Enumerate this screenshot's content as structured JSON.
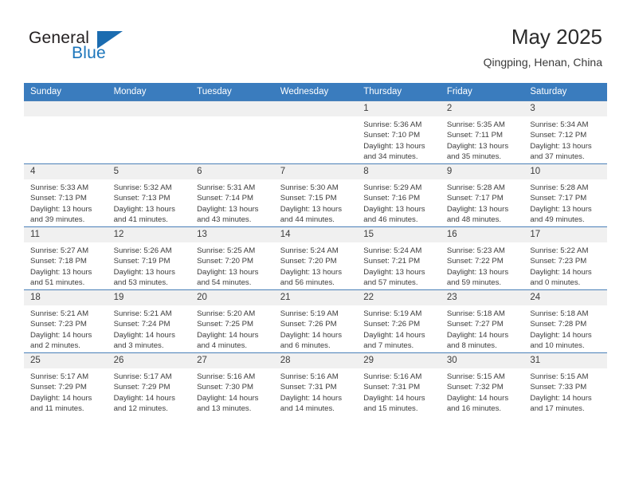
{
  "brand": {
    "name_top": "General",
    "name_bottom": "Blue",
    "flag_icon": "blue-triangle-flag"
  },
  "header": {
    "title": "May 2025",
    "location": "Qingping, Henan, China"
  },
  "theme": {
    "header_blue": "#3a7cbe",
    "brand_blue": "#1b75bb",
    "daynum_bg": "#f0f0f0",
    "text": "#3c3c3c"
  },
  "weekdays": [
    "Sunday",
    "Monday",
    "Tuesday",
    "Wednesday",
    "Thursday",
    "Friday",
    "Saturday"
  ],
  "weeks": [
    [
      {
        "day": "",
        "empty": true
      },
      {
        "day": "",
        "empty": true
      },
      {
        "day": "",
        "empty": true
      },
      {
        "day": "",
        "empty": true
      },
      {
        "day": "1",
        "sunrise": "Sunrise: 5:36 AM",
        "sunset": "Sunset: 7:10 PM",
        "daylight1": "Daylight: 13 hours",
        "daylight2": "and 34 minutes."
      },
      {
        "day": "2",
        "sunrise": "Sunrise: 5:35 AM",
        "sunset": "Sunset: 7:11 PM",
        "daylight1": "Daylight: 13 hours",
        "daylight2": "and 35 minutes."
      },
      {
        "day": "3",
        "sunrise": "Sunrise: 5:34 AM",
        "sunset": "Sunset: 7:12 PM",
        "daylight1": "Daylight: 13 hours",
        "daylight2": "and 37 minutes."
      }
    ],
    [
      {
        "day": "4",
        "sunrise": "Sunrise: 5:33 AM",
        "sunset": "Sunset: 7:13 PM",
        "daylight1": "Daylight: 13 hours",
        "daylight2": "and 39 minutes."
      },
      {
        "day": "5",
        "sunrise": "Sunrise: 5:32 AM",
        "sunset": "Sunset: 7:13 PM",
        "daylight1": "Daylight: 13 hours",
        "daylight2": "and 41 minutes."
      },
      {
        "day": "6",
        "sunrise": "Sunrise: 5:31 AM",
        "sunset": "Sunset: 7:14 PM",
        "daylight1": "Daylight: 13 hours",
        "daylight2": "and 43 minutes."
      },
      {
        "day": "7",
        "sunrise": "Sunrise: 5:30 AM",
        "sunset": "Sunset: 7:15 PM",
        "daylight1": "Daylight: 13 hours",
        "daylight2": "and 44 minutes."
      },
      {
        "day": "8",
        "sunrise": "Sunrise: 5:29 AM",
        "sunset": "Sunset: 7:16 PM",
        "daylight1": "Daylight: 13 hours",
        "daylight2": "and 46 minutes."
      },
      {
        "day": "9",
        "sunrise": "Sunrise: 5:28 AM",
        "sunset": "Sunset: 7:17 PM",
        "daylight1": "Daylight: 13 hours",
        "daylight2": "and 48 minutes."
      },
      {
        "day": "10",
        "sunrise": "Sunrise: 5:28 AM",
        "sunset": "Sunset: 7:17 PM",
        "daylight1": "Daylight: 13 hours",
        "daylight2": "and 49 minutes."
      }
    ],
    [
      {
        "day": "11",
        "sunrise": "Sunrise: 5:27 AM",
        "sunset": "Sunset: 7:18 PM",
        "daylight1": "Daylight: 13 hours",
        "daylight2": "and 51 minutes."
      },
      {
        "day": "12",
        "sunrise": "Sunrise: 5:26 AM",
        "sunset": "Sunset: 7:19 PM",
        "daylight1": "Daylight: 13 hours",
        "daylight2": "and 53 minutes."
      },
      {
        "day": "13",
        "sunrise": "Sunrise: 5:25 AM",
        "sunset": "Sunset: 7:20 PM",
        "daylight1": "Daylight: 13 hours",
        "daylight2": "and 54 minutes."
      },
      {
        "day": "14",
        "sunrise": "Sunrise: 5:24 AM",
        "sunset": "Sunset: 7:20 PM",
        "daylight1": "Daylight: 13 hours",
        "daylight2": "and 56 minutes."
      },
      {
        "day": "15",
        "sunrise": "Sunrise: 5:24 AM",
        "sunset": "Sunset: 7:21 PM",
        "daylight1": "Daylight: 13 hours",
        "daylight2": "and 57 minutes."
      },
      {
        "day": "16",
        "sunrise": "Sunrise: 5:23 AM",
        "sunset": "Sunset: 7:22 PM",
        "daylight1": "Daylight: 13 hours",
        "daylight2": "and 59 minutes."
      },
      {
        "day": "17",
        "sunrise": "Sunrise: 5:22 AM",
        "sunset": "Sunset: 7:23 PM",
        "daylight1": "Daylight: 14 hours",
        "daylight2": "and 0 minutes."
      }
    ],
    [
      {
        "day": "18",
        "sunrise": "Sunrise: 5:21 AM",
        "sunset": "Sunset: 7:23 PM",
        "daylight1": "Daylight: 14 hours",
        "daylight2": "and 2 minutes."
      },
      {
        "day": "19",
        "sunrise": "Sunrise: 5:21 AM",
        "sunset": "Sunset: 7:24 PM",
        "daylight1": "Daylight: 14 hours",
        "daylight2": "and 3 minutes."
      },
      {
        "day": "20",
        "sunrise": "Sunrise: 5:20 AM",
        "sunset": "Sunset: 7:25 PM",
        "daylight1": "Daylight: 14 hours",
        "daylight2": "and 4 minutes."
      },
      {
        "day": "21",
        "sunrise": "Sunrise: 5:19 AM",
        "sunset": "Sunset: 7:26 PM",
        "daylight1": "Daylight: 14 hours",
        "daylight2": "and 6 minutes."
      },
      {
        "day": "22",
        "sunrise": "Sunrise: 5:19 AM",
        "sunset": "Sunset: 7:26 PM",
        "daylight1": "Daylight: 14 hours",
        "daylight2": "and 7 minutes."
      },
      {
        "day": "23",
        "sunrise": "Sunrise: 5:18 AM",
        "sunset": "Sunset: 7:27 PM",
        "daylight1": "Daylight: 14 hours",
        "daylight2": "and 8 minutes."
      },
      {
        "day": "24",
        "sunrise": "Sunrise: 5:18 AM",
        "sunset": "Sunset: 7:28 PM",
        "daylight1": "Daylight: 14 hours",
        "daylight2": "and 10 minutes."
      }
    ],
    [
      {
        "day": "25",
        "sunrise": "Sunrise: 5:17 AM",
        "sunset": "Sunset: 7:29 PM",
        "daylight1": "Daylight: 14 hours",
        "daylight2": "and 11 minutes."
      },
      {
        "day": "26",
        "sunrise": "Sunrise: 5:17 AM",
        "sunset": "Sunset: 7:29 PM",
        "daylight1": "Daylight: 14 hours",
        "daylight2": "and 12 minutes."
      },
      {
        "day": "27",
        "sunrise": "Sunrise: 5:16 AM",
        "sunset": "Sunset: 7:30 PM",
        "daylight1": "Daylight: 14 hours",
        "daylight2": "and 13 minutes."
      },
      {
        "day": "28",
        "sunrise": "Sunrise: 5:16 AM",
        "sunset": "Sunset: 7:31 PM",
        "daylight1": "Daylight: 14 hours",
        "daylight2": "and 14 minutes."
      },
      {
        "day": "29",
        "sunrise": "Sunrise: 5:16 AM",
        "sunset": "Sunset: 7:31 PM",
        "daylight1": "Daylight: 14 hours",
        "daylight2": "and 15 minutes."
      },
      {
        "day": "30",
        "sunrise": "Sunrise: 5:15 AM",
        "sunset": "Sunset: 7:32 PM",
        "daylight1": "Daylight: 14 hours",
        "daylight2": "and 16 minutes."
      },
      {
        "day": "31",
        "sunrise": "Sunrise: 5:15 AM",
        "sunset": "Sunset: 7:33 PM",
        "daylight1": "Daylight: 14 hours",
        "daylight2": "and 17 minutes."
      }
    ]
  ]
}
